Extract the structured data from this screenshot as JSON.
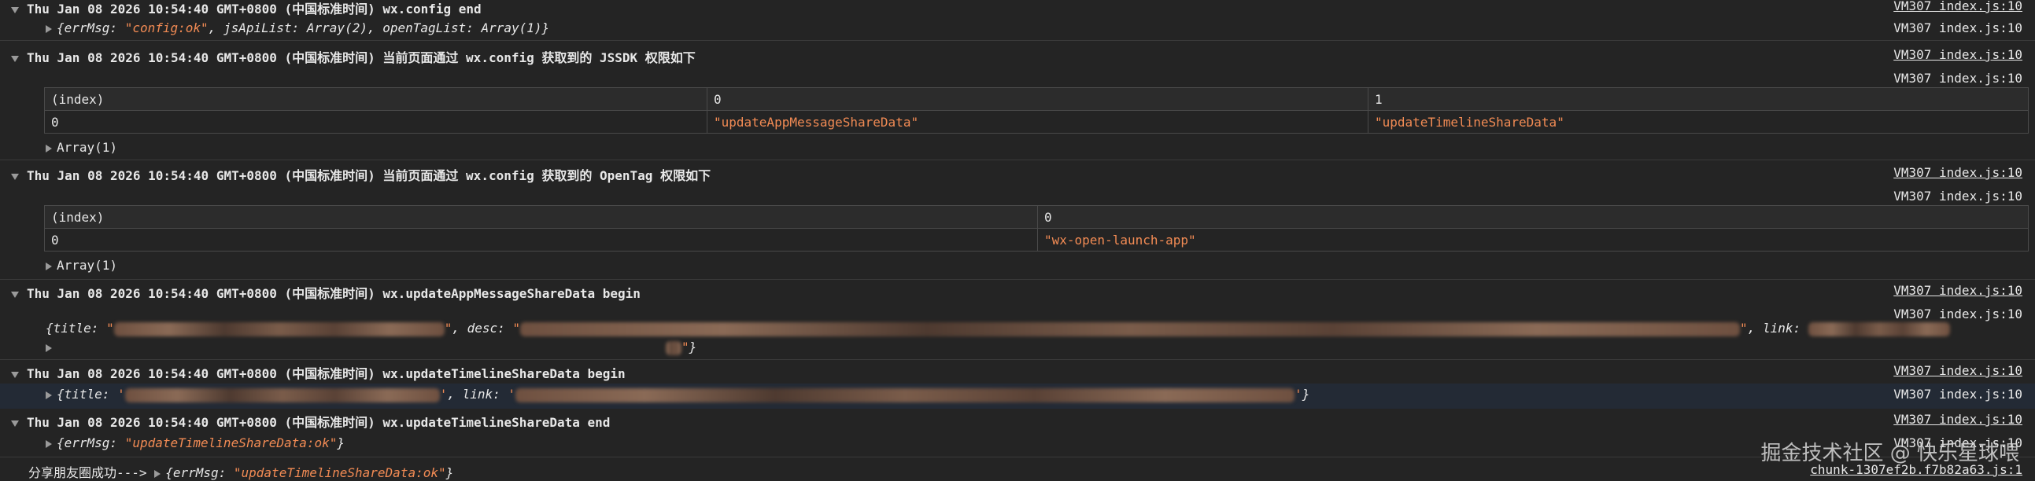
{
  "source_index": "VM307 index.js:10",
  "source_chunk": "chunk-1307ef2b.f7b82a63.js:1",
  "logs": {
    "config_end": {
      "header": "Thu Jan 08 2026 10:54:40 GMT+0800 (中国标准时间) wx.config end",
      "obj_prefix": "{errMsg: ",
      "obj_str": "\"config:ok\"",
      "obj_suffix": ", jsApiList: Array(2), openTagList: Array(1)}"
    },
    "jssdk": {
      "header": "Thu Jan 08 2026 10:54:40 GMT+0800 (中国标准时间) 当前页面通过 wx.config 获取到的 JSSDK 权限如下",
      "table": {
        "headers": [
          "(index)",
          "0",
          "1"
        ],
        "row_index": "0",
        "cells": [
          "\"updateAppMessageShareData\"",
          "\"updateTimelineShareData\""
        ]
      },
      "array_label": "Array(1)"
    },
    "opentag": {
      "header": "Thu Jan 08 2026 10:54:40 GMT+0800 (中国标准时间) 当前页面通过 wx.config 获取到的 OpenTag 权限如下",
      "table": {
        "headers": [
          "(index)",
          "0"
        ],
        "row_index": "0",
        "cells": [
          "\"wx-open-launch-app\""
        ]
      },
      "array_label": "Array(1)"
    },
    "app_msg_begin": {
      "header": "Thu Jan 08 2026 10:54:40 GMT+0800 (中国标准时间) wx.updateAppMessageShareData begin",
      "obj_title": "{title: ",
      "obj_desc": ", desc: ",
      "obj_link": ", link: ",
      "obj_close": "}"
    },
    "timeline_begin": {
      "header": "Thu Jan 08 2026 10:54:40 GMT+0800 (中国标准时间) wx.updateTimelineShareData begin",
      "obj_title": "{title: ",
      "obj_link": ", link: ",
      "obj_close": "}"
    },
    "timeline_end": {
      "header": "Thu Jan 08 2026 10:54:40 GMT+0800 (中国标准时间) wx.updateTimelineShareData end",
      "obj_prefix": "{errMsg: ",
      "obj_str": "\"updateTimelineShareData:ok\"",
      "obj_suffix": "}"
    },
    "share_success": {
      "label": "分享朋友圈成功--->",
      "obj_prefix": "{errMsg: ",
      "obj_str": "\"updateTimelineShareData:ok\"",
      "obj_suffix": "}"
    }
  },
  "watermark": "掘金技术社区 @ 快乐星球喂"
}
